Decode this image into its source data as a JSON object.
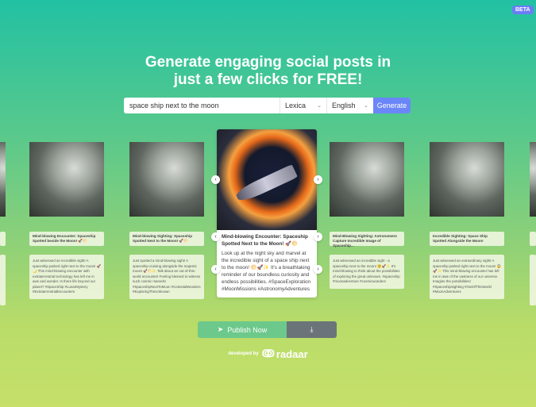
{
  "badge": "BETA",
  "headline": {
    "line1": "Generate engaging social posts in",
    "line2": "just a few clicks for FREE!"
  },
  "search": {
    "value": "space ship next to the moon",
    "source": "Lexica",
    "language": "English",
    "generate_label": "Generate"
  },
  "carousel": {
    "cards": [
      {
        "title": "",
        "body": ""
      },
      {
        "title": "Mind-blowing Encounter: Spaceship Spotted beside the Moon! 🚀🌕",
        "body": "Just witnessed an incredible sight! A spaceship parked right next to the moon! 🚀🌙 This mind-blowing encounter with extraterrestrial technology has left me in awe and wonder. Is there life beyond our planet? #SpaceShip #LunarMystery #ExtraterrestrialEncounters"
      },
      {
        "title": "Mind-blowing Sighting: Spaceship Spotted Next to the Moon! 🚀🌕",
        "body": "Just spotted a mind-blowing sight! A spaceship cruising alongside the majestic moon! 🚀🌕✨ Talk about an out-of-this-world encounter! Feeling blessed to witness such cosmic marvels! #SpaceshipNextToMoon #CelestialWonders #ExploringTheUnknown"
      },
      {
        "title": "Mind-Blowing Sighting: Astronomers Capture Incredible Image of Spaceship...",
        "body": "Just witnessed an incredible sight - a spaceship next to the moon! 😲🚀✨ It's mind-blowing to think about the possibilities of exploring the great unknown. #spaceship #moonadventure #cosmicwonders"
      },
      {
        "title": "Incredible Sighting: Space Ship Spotted Alongside the Moon!",
        "body": "Just witnessed an extraordinary sight! A spaceship parked right next to the moon! 😱🚀✨ This mind-blowing encounter has left me in awe of the vastness of our universe. Imagine the possibilities! #SpaceshipSighting #OutOfThisWorld #MoonAdventures"
      },
      {
        "title": "",
        "body": ""
      }
    ],
    "active": {
      "title": "Mind-blowing Encounter: Spaceship Spotted Next to the Moon! 🚀🌕",
      "body": "Look up at the night sky and marvel at the incredible sight of a space ship next to the moon! 🌕🚀✨ It's a breathtaking reminder of our boundless curiosity and endless possibilities. #SpaceExploration #MoonMissions #AstronomyAdventures"
    }
  },
  "actions": {
    "publish_label": "Publish Now"
  },
  "footer": {
    "developed_by": "developed by",
    "brand": "radaar"
  }
}
